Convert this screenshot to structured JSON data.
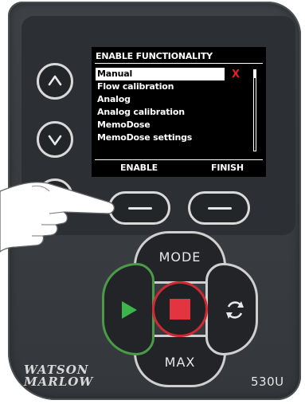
{
  "screen": {
    "title": "ENABLE FUNCTIONALITY",
    "items": [
      {
        "label": "Manual",
        "selected": true
      },
      {
        "label": "Flow calibration",
        "selected": false
      },
      {
        "label": "Analog",
        "selected": false
      },
      {
        "label": "Analog calibration",
        "selected": false
      },
      {
        "label": "MemoDose",
        "selected": false
      },
      {
        "label": "MemoDose settings",
        "selected": false
      }
    ],
    "selected_status": "X",
    "softkeys": {
      "left": "ENABLE",
      "right": "FINISH"
    }
  },
  "keypad": {
    "mode_label": "MODE",
    "max_label": "MAX"
  },
  "brand": {
    "logo_line1": "WATSON",
    "logo_line2": "MARLOW",
    "model": "530U"
  },
  "colors": {
    "status_x": "#e2202a",
    "run_icon": "#3cb54a",
    "stop_icon": "#e2353f",
    "stop_ring": "#cf2a33"
  },
  "icons": {
    "up": "chevron-up-icon",
    "down": "chevron-down-icon",
    "home": "home-icon",
    "run": "play-icon",
    "stop": "stop-icon",
    "cycle": "direction-cycle-icon"
  }
}
